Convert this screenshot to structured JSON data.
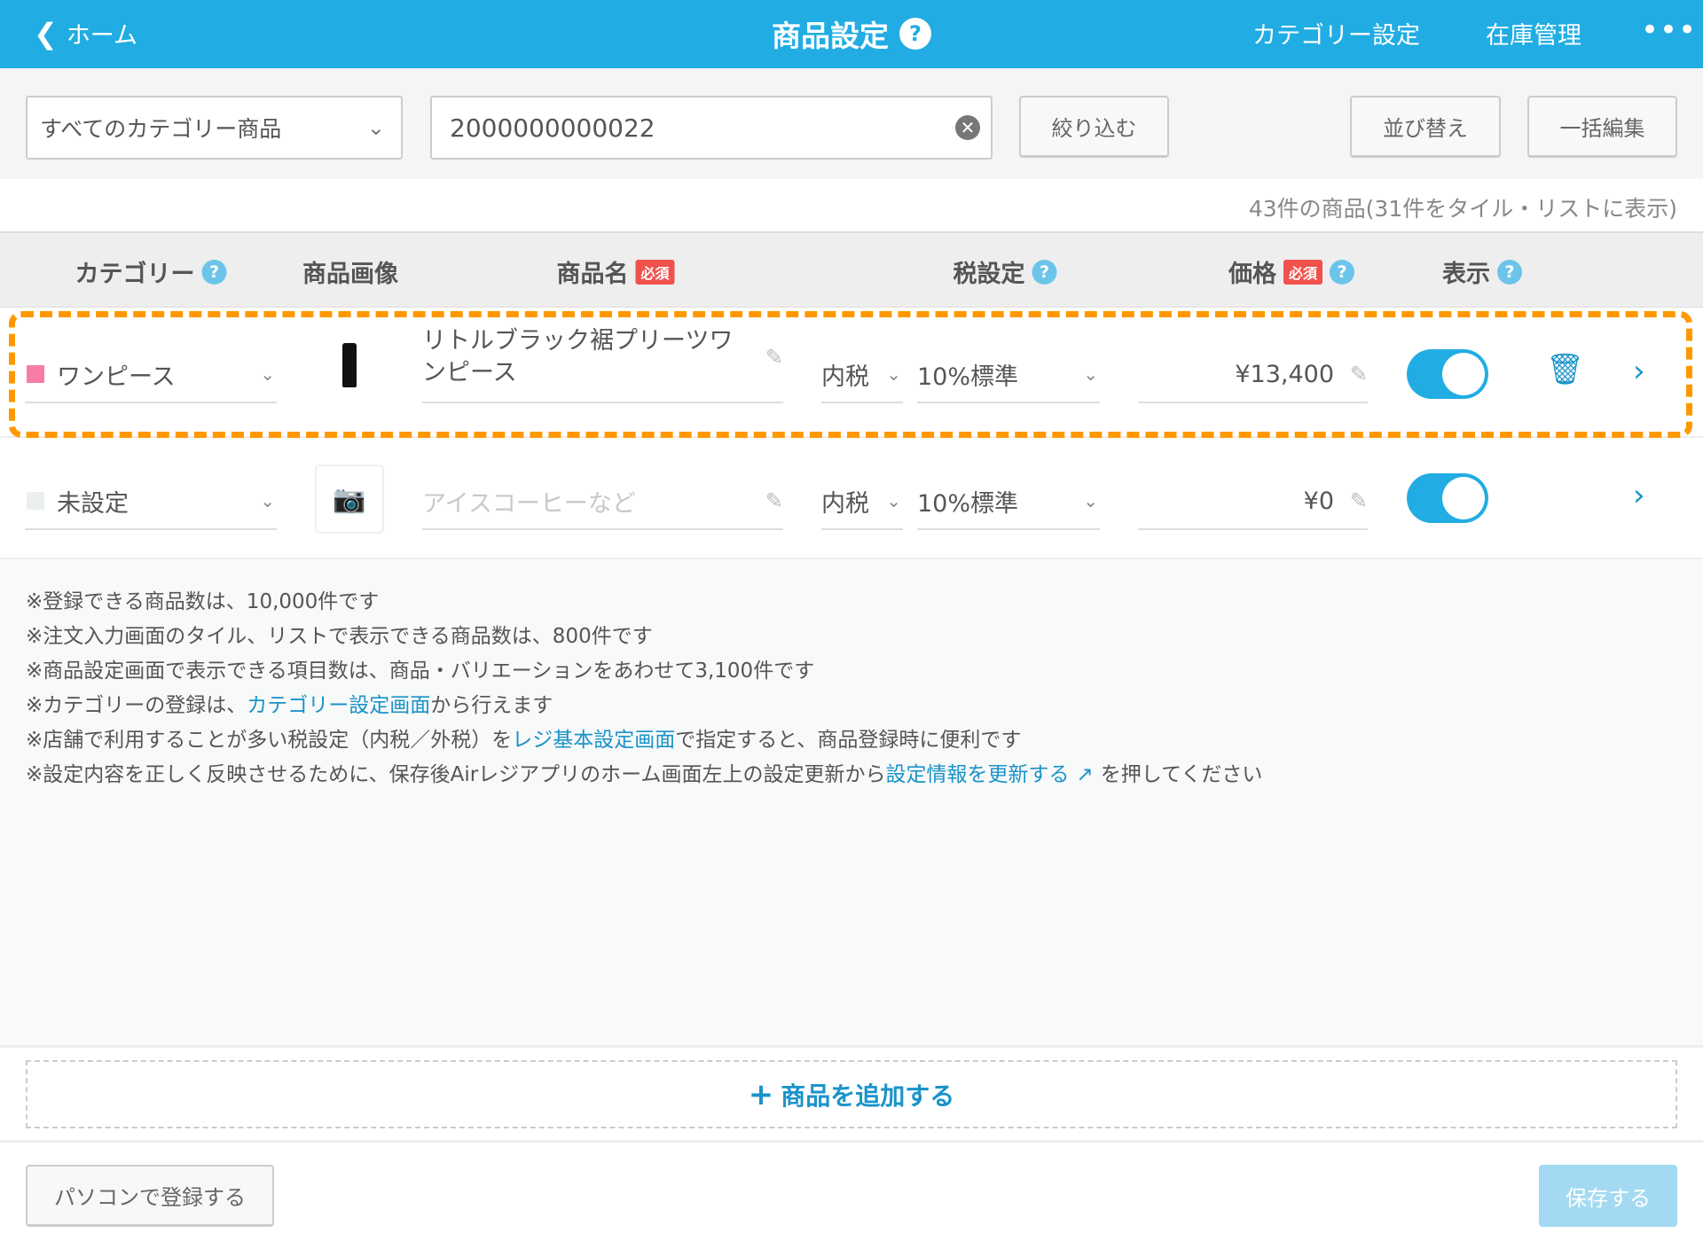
{
  "header": {
    "back_label": "ホーム",
    "title": "商品設定",
    "nav": [
      "カテゴリー設定",
      "在庫管理"
    ],
    "accent": "#21ade3"
  },
  "toolbar": {
    "category_select": "すべてのカテゴリー商品",
    "search_value": "2000000000022",
    "filter_label": "絞り込む",
    "sort_label": "並び替え",
    "bulk_edit_label": "一括編集"
  },
  "count_text": "43件の商品(31件をタイル・リストに表示)",
  "columns": {
    "category": "カテゴリー",
    "image": "商品画像",
    "name": "商品名",
    "tax": "税設定",
    "price": "価格",
    "display": "表示",
    "required": "必須"
  },
  "rows": [
    {
      "category": "ワンピース",
      "category_color": "#f77ca8",
      "name": "リトルブラック裾プリーツワンピース",
      "tax_type": "内税",
      "tax_rate": "10%標準",
      "price": "¥13,400",
      "display_on": true
    },
    {
      "category": "未設定",
      "category_color": "#eceff0",
      "name_placeholder": "アイスコーヒーなど",
      "tax_type": "内税",
      "tax_rate": "10%標準",
      "price": "¥0",
      "display_on": true
    }
  ],
  "notes": {
    "n1": "※登録できる商品数は、10,000件です",
    "n2": "※注文入力画面のタイル、リストで表示できる商品数は、800件です",
    "n3": "※商品設定画面で表示できる項目数は、商品・バリエーションをあわせて3,100件です",
    "n4a": "※カテゴリーの登録は、",
    "n4link": "カテゴリー設定画面",
    "n4b": "から行えます",
    "n5a": "※店舗で利用することが多い税設定（内税／外税）を",
    "n5link": "レジ基本設定画面",
    "n5b": "で指定すると、商品登録時に便利です",
    "n6a": "※設定内容を正しく反映させるために、保存後Airレジアプリのホーム画面左上の設定更新から",
    "n6link": "設定情報を更新する",
    "n6b": "を押してください"
  },
  "add_label": "商品を追加する",
  "footer": {
    "pc_label": "パソコンで登録する",
    "save_label": "保存する"
  }
}
